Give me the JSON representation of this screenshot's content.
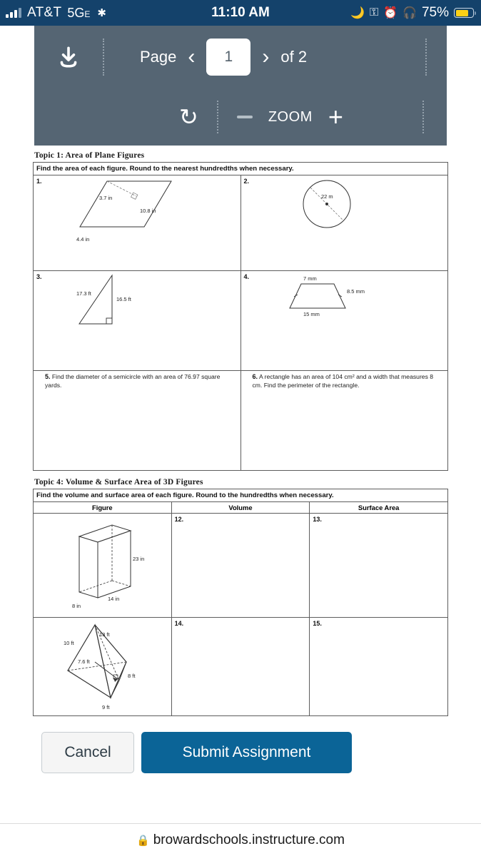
{
  "status_bar": {
    "carrier": "AT&T",
    "network": "5G",
    "network_sub": "E",
    "spark_icon": "loading-spark-icon",
    "time": "11:10 AM",
    "icons": [
      "moon-icon",
      "rotation-lock-icon",
      "alarm-clock-icon",
      "headphones-icon"
    ],
    "battery_percent": "75%",
    "battery_level": 75,
    "bg_color": "#14426b"
  },
  "toolbar": {
    "download_icon": "download-icon",
    "page_label": "Page",
    "prev_icon": "chevron-left-icon",
    "page_value": "1",
    "next_icon": "chevron-right-icon",
    "of_label": "of 2",
    "rotate_icon": "rotate-icon",
    "zoom_out_icon": "minus-icon",
    "zoom_label": "ZOOM",
    "zoom_in_icon": "plus-icon",
    "bg_color": "#556573"
  },
  "worksheet": {
    "topic1": {
      "title": "Topic 1: Area of Plane Figures",
      "instruction": "Find the area of each figure.  Round to the nearest hundredths when necessary.",
      "problems": [
        {
          "num": "1.",
          "type": "figure",
          "shape": "parallelogram",
          "labels": [
            "3.7 in",
            "10.8 in",
            "4.4 in"
          ]
        },
        {
          "num": "2.",
          "type": "figure",
          "shape": "circle",
          "labels": [
            "22 m"
          ]
        },
        {
          "num": "3.",
          "type": "figure",
          "shape": "right-triangle",
          "labels": [
            "17.3 ft",
            "16.5 ft"
          ]
        },
        {
          "num": "4.",
          "type": "figure",
          "shape": "trapezoid",
          "labels": [
            "7 mm",
            "8.5 mm",
            "15 mm"
          ]
        },
        {
          "num": "5.",
          "type": "text",
          "text": "Find the diameter of a semicircle with an area of 76.97 square yards."
        },
        {
          "num": "6.",
          "type": "text",
          "text": "A rectangle has an area of 104 cm² and a width that measures 8 cm.  Find the perimeter of the rectangle."
        }
      ]
    },
    "topic4": {
      "title": "Topic 4: Volume & Surface Area of 3D Figures",
      "instruction": "Find the volume and surface area of each figure.  Round to the hundredths when necessary.",
      "columns": [
        "Figure",
        "Volume",
        "Surface Area"
      ],
      "rows": [
        {
          "figure": {
            "shape": "rectangular-prism",
            "labels": [
              "23 in",
              "14 in",
              "8 in"
            ]
          },
          "volume_num": "12.",
          "surface_num": "13."
        },
        {
          "figure": {
            "shape": "triangular-pyramid",
            "labels": [
              "10 ft",
              "13 ft",
              "7.6 ft",
              "8 ft",
              "9 ft"
            ]
          },
          "volume_num": "14.",
          "surface_num": "15."
        }
      ]
    }
  },
  "footer": {
    "cancel_label": "Cancel",
    "submit_label": "Submit Assignment",
    "submit_color": "#0b6497",
    "lock_icon": "lock-icon",
    "url": "browardschools.instructure.com"
  }
}
